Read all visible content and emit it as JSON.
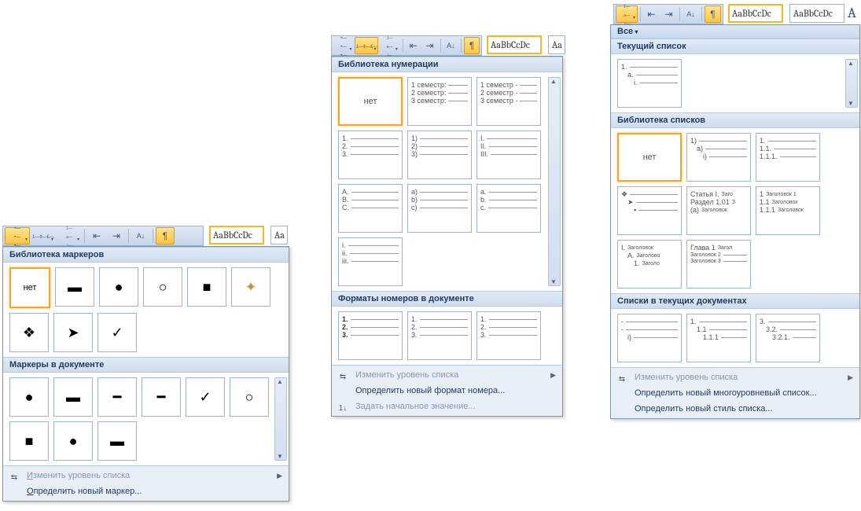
{
  "ribbon": {
    "style_label_1": "AaBbCcDc",
    "style_label_2": "AaBbCcDc",
    "cut_a": "Aa",
    "big_a": "A"
  },
  "panel1": {
    "section_library": "Библиотека маркеров",
    "section_doc": "Маркеры в документе",
    "none": "нет",
    "menu_change_level": "Изменить уровень списка",
    "menu_change_level_u": "И",
    "menu_define": "Определить новый маркер...",
    "menu_define_u": "О"
  },
  "panel2": {
    "section_library": "Библиотека нумерации",
    "section_doc": "Форматы номеров в документе",
    "none": "нет",
    "r1": [
      "1 семестр:",
      "2 семестр:",
      "3 семестр:"
    ],
    "r1b": [
      "1 семестр -",
      "2 семестр -",
      "3 семестр -"
    ],
    "r2a": [
      "1.",
      "2.",
      "3."
    ],
    "r2b": [
      "1)",
      "2)",
      "3)"
    ],
    "r2c": [
      "I.",
      "II.",
      "III."
    ],
    "r3a": [
      "A.",
      "B.",
      "C."
    ],
    "r3b": [
      "a)",
      "b)",
      "c)"
    ],
    "r3c": [
      "a.",
      "b.",
      "c."
    ],
    "r4a": [
      "i.",
      "ii.",
      "iii."
    ],
    "doc_a": [
      "1.",
      "2.",
      "3."
    ],
    "doc_b": [
      "1.",
      "2.",
      "3."
    ],
    "doc_c": [
      "1.",
      "2.",
      "3."
    ],
    "menu_change_level": "Изменить уровень списка",
    "menu_define_format": "Определить новый формат номера...",
    "menu_set_start": "Задать начальное значение..."
  },
  "panel3": {
    "all": "Все",
    "section_current": "Текущий список",
    "section_library": "Библиотека списков",
    "section_doc": "Списки в текущих документах",
    "none": "нет",
    "cur": [
      "1.",
      "a.",
      "i."
    ],
    "lib_b": [
      "1)",
      "a)",
      "i)"
    ],
    "lib_c": [
      "1.",
      "1.1.",
      "1.1.1."
    ],
    "lib_d": [
      "❖",
      "➤",
      "▪"
    ],
    "lib_e": [
      "Статья I.",
      "Заго",
      "Раздел 1.01",
      "З",
      "(a)",
      "Заголовок"
    ],
    "lib_f": [
      "1",
      "Заголовок 1",
      "1.1",
      "Заголовок",
      "1.1.1",
      "Заголовок"
    ],
    "lib_g": [
      "I.",
      "Заголовок",
      "A.",
      "Заголово",
      "1.",
      "Заголо"
    ],
    "lib_h": [
      "Глава 1",
      "Загол",
      "Заголовок 2",
      "Заголовок 3"
    ],
    "doc_a": [
      "-",
      "-",
      "i)"
    ],
    "doc_b": [
      "1.",
      "1.1",
      "1.1.1"
    ],
    "doc_c": [
      "3.",
      "3.2.",
      "3.2.1."
    ],
    "menu_change_level": "Изменить уровень списка",
    "menu_define_ml": "Определить новый многоуровневый список...",
    "menu_define_style": "Определить новый стиль списка..."
  }
}
